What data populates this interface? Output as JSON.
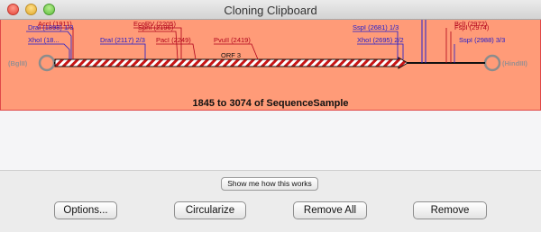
{
  "window": {
    "title": "Cloning Clipboard"
  },
  "map": {
    "left_end": "(BglII)",
    "right_end": "(HindIII)",
    "orf_label": "ORF 3",
    "sequence_title": "1845 to 3074 of SequenceSample",
    "sites": [
      {
        "id": "accI",
        "label": "AccI (1911)",
        "color": "#b0001a"
      },
      {
        "id": "draI-1898",
        "label": "DraI (1898) 1/3",
        "color": "#1a1ad0"
      },
      {
        "id": "xhoI-18",
        "label": "XhoI (18...",
        "color": "#1a1ad0"
      },
      {
        "id": "draI-2117",
        "label": "DraI (2117) 2/3",
        "color": "#1a1ad0"
      },
      {
        "id": "ecoRV",
        "label": "EcoRV (2205)",
        "color": "#b0001a"
      },
      {
        "id": "sphI",
        "label": "SphI (2196)",
        "color": "#b0001a"
      },
      {
        "id": "pacI",
        "label": "PacI (2249)",
        "color": "#b0001a"
      },
      {
        "id": "pvuII",
        "label": "PvuII (2419)",
        "color": "#b0001a"
      },
      {
        "id": "sspI-2681",
        "label": "SspI (2681) 1/3",
        "color": "#1a1ad0"
      },
      {
        "id": "xhoI-2695",
        "label": "XhoI (2695) 2/2",
        "color": "#1a1ad0"
      },
      {
        "id": "bclI",
        "label": "BclI (2972)",
        "color": "#b0001a"
      },
      {
        "id": "fspI",
        "label": "FspI (2974)",
        "color": "#b0001a"
      },
      {
        "id": "sspI-2988",
        "label": "SspI (2988) 3/3",
        "color": "#1a1ad0"
      }
    ]
  },
  "buttons": {
    "how_it_works": "Show me how this works",
    "options": "Options...",
    "circularize": "Circularize",
    "remove_all": "Remove All",
    "remove": "Remove"
  }
}
